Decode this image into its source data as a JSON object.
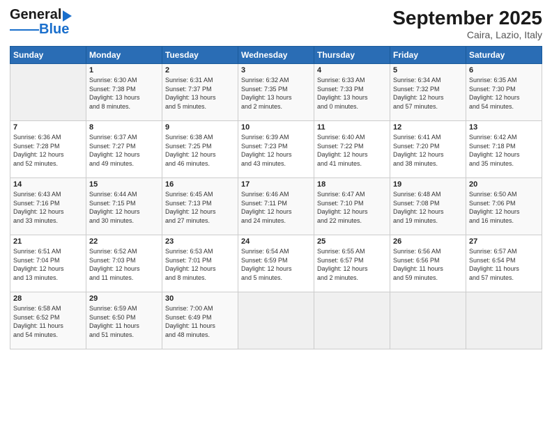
{
  "header": {
    "logo_general": "General",
    "logo_blue": "Blue",
    "month_title": "September 2025",
    "location": "Caira, Lazio, Italy"
  },
  "columns": [
    "Sunday",
    "Monday",
    "Tuesday",
    "Wednesday",
    "Thursday",
    "Friday",
    "Saturday"
  ],
  "rows": [
    [
      {
        "day": "",
        "content": ""
      },
      {
        "day": "1",
        "content": "Sunrise: 6:30 AM\nSunset: 7:38 PM\nDaylight: 13 hours\nand 8 minutes."
      },
      {
        "day": "2",
        "content": "Sunrise: 6:31 AM\nSunset: 7:37 PM\nDaylight: 13 hours\nand 5 minutes."
      },
      {
        "day": "3",
        "content": "Sunrise: 6:32 AM\nSunset: 7:35 PM\nDaylight: 13 hours\nand 2 minutes."
      },
      {
        "day": "4",
        "content": "Sunrise: 6:33 AM\nSunset: 7:33 PM\nDaylight: 13 hours\nand 0 minutes."
      },
      {
        "day": "5",
        "content": "Sunrise: 6:34 AM\nSunset: 7:32 PM\nDaylight: 12 hours\nand 57 minutes."
      },
      {
        "day": "6",
        "content": "Sunrise: 6:35 AM\nSunset: 7:30 PM\nDaylight: 12 hours\nand 54 minutes."
      }
    ],
    [
      {
        "day": "7",
        "content": "Sunrise: 6:36 AM\nSunset: 7:28 PM\nDaylight: 12 hours\nand 52 minutes."
      },
      {
        "day": "8",
        "content": "Sunrise: 6:37 AM\nSunset: 7:27 PM\nDaylight: 12 hours\nand 49 minutes."
      },
      {
        "day": "9",
        "content": "Sunrise: 6:38 AM\nSunset: 7:25 PM\nDaylight: 12 hours\nand 46 minutes."
      },
      {
        "day": "10",
        "content": "Sunrise: 6:39 AM\nSunset: 7:23 PM\nDaylight: 12 hours\nand 43 minutes."
      },
      {
        "day": "11",
        "content": "Sunrise: 6:40 AM\nSunset: 7:22 PM\nDaylight: 12 hours\nand 41 minutes."
      },
      {
        "day": "12",
        "content": "Sunrise: 6:41 AM\nSunset: 7:20 PM\nDaylight: 12 hours\nand 38 minutes."
      },
      {
        "day": "13",
        "content": "Sunrise: 6:42 AM\nSunset: 7:18 PM\nDaylight: 12 hours\nand 35 minutes."
      }
    ],
    [
      {
        "day": "14",
        "content": "Sunrise: 6:43 AM\nSunset: 7:16 PM\nDaylight: 12 hours\nand 33 minutes."
      },
      {
        "day": "15",
        "content": "Sunrise: 6:44 AM\nSunset: 7:15 PM\nDaylight: 12 hours\nand 30 minutes."
      },
      {
        "day": "16",
        "content": "Sunrise: 6:45 AM\nSunset: 7:13 PM\nDaylight: 12 hours\nand 27 minutes."
      },
      {
        "day": "17",
        "content": "Sunrise: 6:46 AM\nSunset: 7:11 PM\nDaylight: 12 hours\nand 24 minutes."
      },
      {
        "day": "18",
        "content": "Sunrise: 6:47 AM\nSunset: 7:10 PM\nDaylight: 12 hours\nand 22 minutes."
      },
      {
        "day": "19",
        "content": "Sunrise: 6:48 AM\nSunset: 7:08 PM\nDaylight: 12 hours\nand 19 minutes."
      },
      {
        "day": "20",
        "content": "Sunrise: 6:50 AM\nSunset: 7:06 PM\nDaylight: 12 hours\nand 16 minutes."
      }
    ],
    [
      {
        "day": "21",
        "content": "Sunrise: 6:51 AM\nSunset: 7:04 PM\nDaylight: 12 hours\nand 13 minutes."
      },
      {
        "day": "22",
        "content": "Sunrise: 6:52 AM\nSunset: 7:03 PM\nDaylight: 12 hours\nand 11 minutes."
      },
      {
        "day": "23",
        "content": "Sunrise: 6:53 AM\nSunset: 7:01 PM\nDaylight: 12 hours\nand 8 minutes."
      },
      {
        "day": "24",
        "content": "Sunrise: 6:54 AM\nSunset: 6:59 PM\nDaylight: 12 hours\nand 5 minutes."
      },
      {
        "day": "25",
        "content": "Sunrise: 6:55 AM\nSunset: 6:57 PM\nDaylight: 12 hours\nand 2 minutes."
      },
      {
        "day": "26",
        "content": "Sunrise: 6:56 AM\nSunset: 6:56 PM\nDaylight: 11 hours\nand 59 minutes."
      },
      {
        "day": "27",
        "content": "Sunrise: 6:57 AM\nSunset: 6:54 PM\nDaylight: 11 hours\nand 57 minutes."
      }
    ],
    [
      {
        "day": "28",
        "content": "Sunrise: 6:58 AM\nSunset: 6:52 PM\nDaylight: 11 hours\nand 54 minutes."
      },
      {
        "day": "29",
        "content": "Sunrise: 6:59 AM\nSunset: 6:50 PM\nDaylight: 11 hours\nand 51 minutes."
      },
      {
        "day": "30",
        "content": "Sunrise: 7:00 AM\nSunset: 6:49 PM\nDaylight: 11 hours\nand 48 minutes."
      },
      {
        "day": "",
        "content": ""
      },
      {
        "day": "",
        "content": ""
      },
      {
        "day": "",
        "content": ""
      },
      {
        "day": "",
        "content": ""
      }
    ]
  ]
}
